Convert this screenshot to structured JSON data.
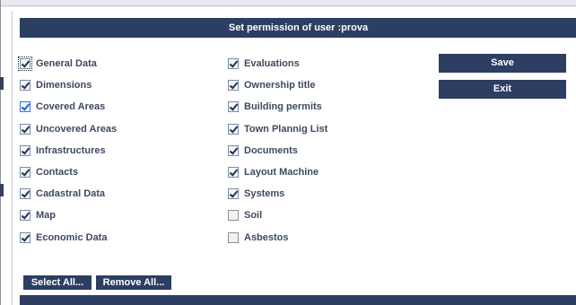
{
  "dialog": {
    "title": "Set permission of user :prova"
  },
  "permissions": {
    "left": [
      {
        "label": "General Data",
        "checked": true
      },
      {
        "label": "Dimensions",
        "checked": true
      },
      {
        "label": "Covered Areas",
        "checked": true
      },
      {
        "label": "Uncovered Areas",
        "checked": true
      },
      {
        "label": "Infrastructures",
        "checked": true
      },
      {
        "label": "Contacts",
        "checked": true
      },
      {
        "label": "Cadastral Data",
        "checked": true
      },
      {
        "label": "Map",
        "checked": true
      },
      {
        "label": "Economic Data",
        "checked": true
      }
    ],
    "right": [
      {
        "label": "Evaluations",
        "checked": true
      },
      {
        "label": "Ownership title",
        "checked": true
      },
      {
        "label": "Building permits",
        "checked": true
      },
      {
        "label": "Town Plannig List",
        "checked": true
      },
      {
        "label": "Documents",
        "checked": true
      },
      {
        "label": "Layout Machine",
        "checked": true
      },
      {
        "label": "Systems",
        "checked": true
      },
      {
        "label": "Soil",
        "checked": false
      },
      {
        "label": "Asbestos",
        "checked": false
      }
    ]
  },
  "actions": {
    "save_label": "Save",
    "exit_label": "Exit",
    "select_all_label": "Select All...",
    "remove_all_label": "Remove All..."
  },
  "colors": {
    "primary": "#2d3e63",
    "label_text": "#3d4a5f"
  }
}
